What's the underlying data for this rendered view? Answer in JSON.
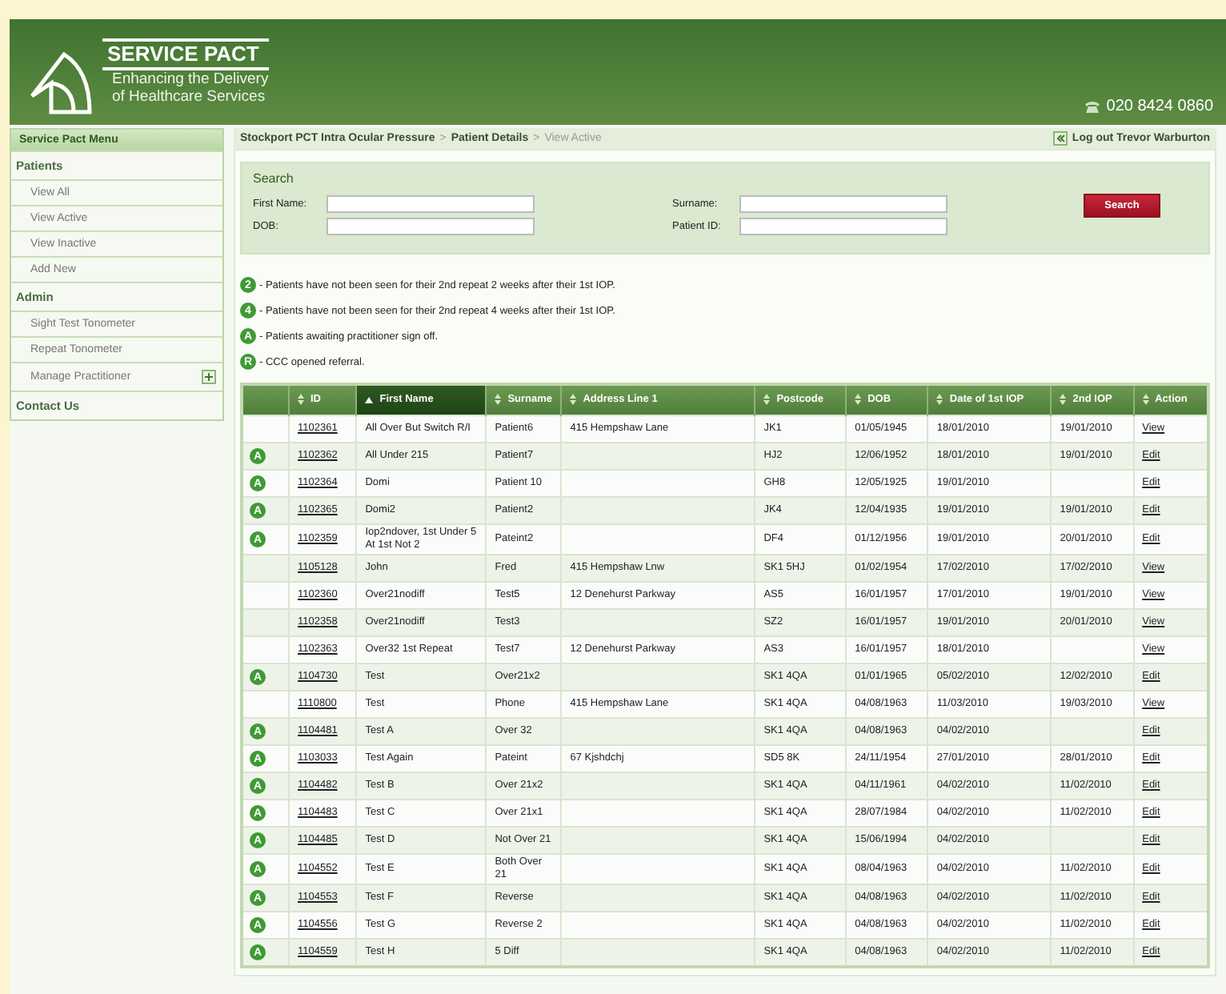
{
  "header": {
    "brand": "SERVICE PACT",
    "tagline_1": "Enhancing the Delivery",
    "tagline_2": "of Healthcare Services",
    "phone": "020 8424 0860"
  },
  "sidebar": {
    "title": "Service Pact Menu",
    "sections": [
      {
        "label": "Patients",
        "items": [
          {
            "label": "View All",
            "expandable": false
          },
          {
            "label": "View Active",
            "expandable": false
          },
          {
            "label": "View Inactive",
            "expandable": false
          },
          {
            "label": "Add New",
            "expandable": false
          }
        ]
      },
      {
        "label": "Admin",
        "items": [
          {
            "label": "Sight Test Tonometer",
            "expandable": false
          },
          {
            "label": "Repeat Tonometer",
            "expandable": false
          },
          {
            "label": "Manage Practitioner",
            "expandable": true
          }
        ]
      },
      {
        "label": "Contact Us"
      }
    ]
  },
  "breadcrumb": [
    {
      "label": "Stockport PCT Intra Ocular Pressure",
      "current": false
    },
    {
      "separator": ">",
      "label": "Patient Details",
      "current": false
    },
    {
      "separator": ">",
      "label": "View Active",
      "current": true
    }
  ],
  "logout": "Log out Trevor Warburton",
  "search": {
    "title": "Search",
    "fields": [
      {
        "label": "First Name:"
      },
      {
        "label": "Surname:"
      },
      {
        "label": "DOB:"
      },
      {
        "label": "Patient ID:"
      }
    ],
    "button": "Search"
  },
  "legend": [
    {
      "badge": "2",
      "text": "- Patients have not been seen for their 2nd repeat 2 weeks after their 1st IOP."
    },
    {
      "badge": "4",
      "text": "- Patients have not been seen for their 2nd repeat 4 weeks after their 1st IOP."
    },
    {
      "badge": "A",
      "text": "- Patients awaiting practitioner sign off."
    },
    {
      "badge": "R",
      "text": "- CCC opened referral."
    }
  ],
  "table": {
    "columns": [
      {
        "label": "ID",
        "selected": false
      },
      {
        "label": "First Name",
        "selected": true
      },
      {
        "label": "Surname",
        "selected": false
      },
      {
        "label": "Address Line 1",
        "selected": false
      },
      {
        "label": "Postcode",
        "selected": false
      },
      {
        "label": "DOB",
        "selected": false
      },
      {
        "label": "Date of 1st IOP",
        "selected": false
      },
      {
        "label": "2nd IOP",
        "selected": false
      },
      {
        "label": "Action",
        "selected": false
      }
    ],
    "rows": [
      {
        "cells": [
          "1102361",
          "All Over But Switch R/I",
          "Patient6",
          "415 Hempshaw Lane",
          "JK1",
          "01/05/1945",
          "18/01/2010",
          "19/01/2010",
          "View"
        ]
      },
      {
        "badge": "A",
        "cells": [
          "1102362",
          "All Under 215",
          "Patient7",
          "",
          "HJ2",
          "12/06/1952",
          "18/01/2010",
          "19/01/2010",
          "Edit"
        ]
      },
      {
        "badge": "A",
        "cells": [
          "1102364",
          "Domi",
          "Patient 10",
          "",
          "GH8",
          "12/05/1925",
          "19/01/2010",
          "",
          "Edit"
        ]
      },
      {
        "badge": "A",
        "cells": [
          "1102365",
          "Domi2",
          "Patient2",
          "",
          "JK4",
          "12/04/1935",
          "19/01/2010",
          "19/01/2010",
          "Edit"
        ]
      },
      {
        "badge": "A",
        "cells": [
          "1102359",
          "Iop2ndover, 1st Under 5 At 1st Not 2",
          "Pateint2",
          "",
          "DF4",
          "01/12/1956",
          "19/01/2010",
          "20/01/2010",
          "Edit"
        ]
      },
      {
        "cells": [
          "1105128",
          "John",
          "Fred",
          "415 Hempshaw Lnw",
          "SK1 5HJ",
          "01/02/1954",
          "17/02/2010",
          "17/02/2010",
          "View"
        ]
      },
      {
        "cells": [
          "1102360",
          "Over21nodiff",
          "Test5",
          "12 Denehurst Parkway",
          "AS5",
          "16/01/1957",
          "17/01/2010",
          "19/01/2010",
          "View"
        ]
      },
      {
        "cells": [
          "1102358",
          "Over21nodiff",
          "Test3",
          "",
          "SZ2",
          "16/01/1957",
          "19/01/2010",
          "20/01/2010",
          "View"
        ]
      },
      {
        "cells": [
          "1102363",
          "Over32 1st Repeat",
          "Test7",
          "12 Denehurst Parkway",
          "AS3",
          "16/01/1957",
          "18/01/2010",
          "",
          "View"
        ]
      },
      {
        "badge": "A",
        "cells": [
          "1104730",
          "Test",
          "Over21x2",
          "",
          "SK1 4QA",
          "01/01/1965",
          "05/02/2010",
          "12/02/2010",
          "Edit"
        ]
      },
      {
        "cells": [
          "1110800",
          "Test",
          "Phone",
          "415 Hempshaw Lane",
          "SK1 4QA",
          "04/08/1963",
          "11/03/2010",
          "19/03/2010",
          "View"
        ]
      },
      {
        "badge": "A",
        "cells": [
          "1104481",
          "Test A",
          "Over 32",
          "",
          "SK1 4QA",
          "04/08/1963",
          "04/02/2010",
          "",
          "Edit"
        ]
      },
      {
        "badge": "A",
        "cells": [
          "1103033",
          "Test Again",
          "Pateint",
          "67 Kjshdchj",
          "SD5 8K",
          "24/11/1954",
          "27/01/2010",
          "28/01/2010",
          "Edit"
        ]
      },
      {
        "badge": "A",
        "cells": [
          "1104482",
          "Test B",
          "Over 21x2",
          "",
          "SK1 4QA",
          "04/11/1961",
          "04/02/2010",
          "11/02/2010",
          "Edit"
        ]
      },
      {
        "badge": "A",
        "cells": [
          "1104483",
          "Test C",
          "Over 21x1",
          "",
          "SK1 4QA",
          "28/07/1984",
          "04/02/2010",
          "11/02/2010",
          "Edit"
        ]
      },
      {
        "badge": "A",
        "cells": [
          "1104485",
          "Test D",
          "Not Over 21",
          "",
          "SK1 4QA",
          "15/06/1994",
          "04/02/2010",
          "",
          "Edit"
        ]
      },
      {
        "badge": "A",
        "cells": [
          "1104552",
          "Test E",
          "Both Over 21",
          "",
          "SK1 4QA",
          "08/04/1963",
          "04/02/2010",
          "11/02/2010",
          "Edit"
        ]
      },
      {
        "badge": "A",
        "cells": [
          "1104553",
          "Test F",
          "Reverse",
          "",
          "SK1 4QA",
          "04/08/1963",
          "04/02/2010",
          "11/02/2010",
          "Edit"
        ]
      },
      {
        "badge": "A",
        "cells": [
          "1104556",
          "Test G",
          "Reverse 2",
          "",
          "SK1 4QA",
          "04/08/1963",
          "04/02/2010",
          "11/02/2010",
          "Edit"
        ]
      },
      {
        "badge": "A",
        "cells": [
          "1104559",
          "Test H",
          "5 Diff",
          "",
          "SK1 4QA",
          "04/08/1963",
          "04/02/2010",
          "11/02/2010",
          "Edit"
        ]
      }
    ]
  }
}
